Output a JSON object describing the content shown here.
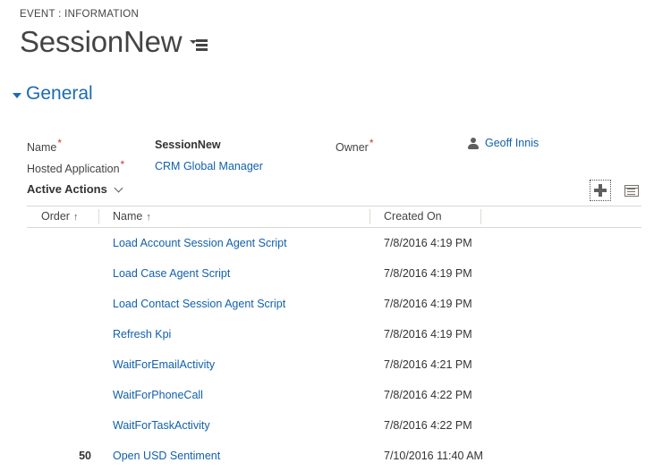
{
  "header": {
    "breadcrumb": "EVENT : INFORMATION",
    "record_title": "SessionNew",
    "form_selector_icon": "form-selector-icon"
  },
  "section": {
    "collapse_icon": "collapse-caret-icon",
    "title": "General"
  },
  "fields": {
    "name": {
      "label": "Name",
      "required": "*",
      "value": "SessionNew"
    },
    "hosted_application": {
      "label": "Hosted Application",
      "required": "*",
      "value": "CRM Global Manager"
    },
    "owner": {
      "label": "Owner",
      "required": "*",
      "value": "Geoff Innis",
      "icon": "person-icon"
    }
  },
  "subgrid": {
    "label": "Active Actions",
    "dropdown_icon": "chevron-down-icon",
    "add_button": {
      "icon": "plus-icon",
      "focused": true
    },
    "view_button": {
      "icon": "grid-view-icon"
    },
    "columns": [
      {
        "label": "Order",
        "sort": "↑"
      },
      {
        "label": "Name",
        "sort": "↑"
      },
      {
        "label": "Created On",
        "sort": ""
      },
      {
        "label": "",
        "sort": ""
      }
    ],
    "rows": [
      {
        "order": "",
        "name": "Load Account Session Agent Script",
        "created_on": "7/8/2016 4:19 PM"
      },
      {
        "order": "",
        "name": "Load Case Agent Script",
        "created_on": "7/8/2016 4:19 PM"
      },
      {
        "order": "",
        "name": "Load Contact Session Agent Script",
        "created_on": "7/8/2016 4:19 PM"
      },
      {
        "order": "",
        "name": "Refresh Kpi",
        "created_on": "7/8/2016 4:19 PM"
      },
      {
        "order": "",
        "name": "WaitForEmailActivity",
        "created_on": "7/8/2016 4:21 PM"
      },
      {
        "order": "",
        "name": "WaitForPhoneCall",
        "created_on": "7/8/2016 4:22 PM"
      },
      {
        "order": "",
        "name": "WaitForTaskActivity",
        "created_on": "7/8/2016 4:22 PM"
      },
      {
        "order": "50",
        "name": "Open USD Sentiment",
        "created_on": "7/10/2016 11:40 AM"
      }
    ]
  },
  "colors": {
    "link": "#1160ac",
    "section_title": "#1a6bb5",
    "required_star": "#d13438",
    "text": "#333333",
    "grid_line": "#d8d8d8",
    "col_divider": "#e2d9cf"
  }
}
